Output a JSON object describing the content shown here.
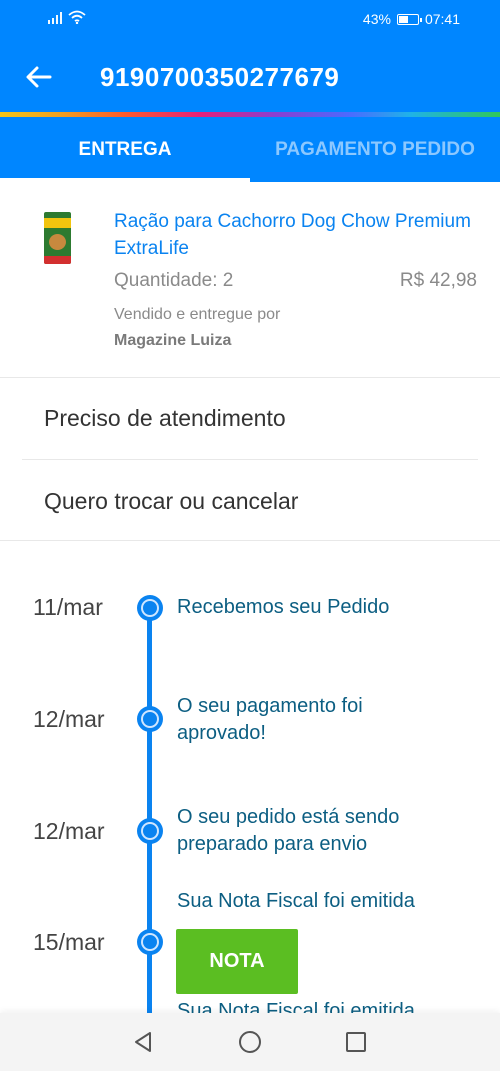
{
  "status_bar": {
    "battery": "43%",
    "battery_level": 0.43,
    "time": "07:41"
  },
  "header": {
    "order_number": "9190700350277679",
    "back_icon": "arrow-left-icon"
  },
  "tabs": [
    {
      "label": "ENTREGA",
      "active": true
    },
    {
      "label": "PAGAMENTO PEDIDO",
      "active": false
    }
  ],
  "product": {
    "name": "Ração para Cachorro Dog Chow Premium ExtraLife",
    "quantity": "Quantidade: 2",
    "price": "R$ 42,98",
    "sold_by": "Vendido e entregue por",
    "seller": "Magazine Luiza"
  },
  "menu": [
    {
      "label": "Preciso de atendimento"
    },
    {
      "label": "Quero trocar ou cancelar"
    }
  ],
  "timeline": [
    {
      "date": "11/mar",
      "text": "Recebemos seu Pedido"
    },
    {
      "date": "12/mar",
      "text": "O seu pagamento foi aprovado!"
    },
    {
      "date": "12/mar",
      "text": "O seu pedido está sendo preparado para envio"
    },
    {
      "date": "15/mar",
      "text": "Sua Nota Fiscal foi emitida",
      "button": "NOTA"
    },
    {
      "date": "",
      "text": "Sua Nota Fiscal foi emitida"
    }
  ],
  "colors": {
    "primary": "#0086ff",
    "link": "#0a83f0",
    "timeline_text": "#0c5e82",
    "button_green": "#5bbe22"
  },
  "nav_bar": {
    "icons": [
      "triangle-back-icon",
      "circle-home-icon",
      "square-recents-icon"
    ]
  }
}
